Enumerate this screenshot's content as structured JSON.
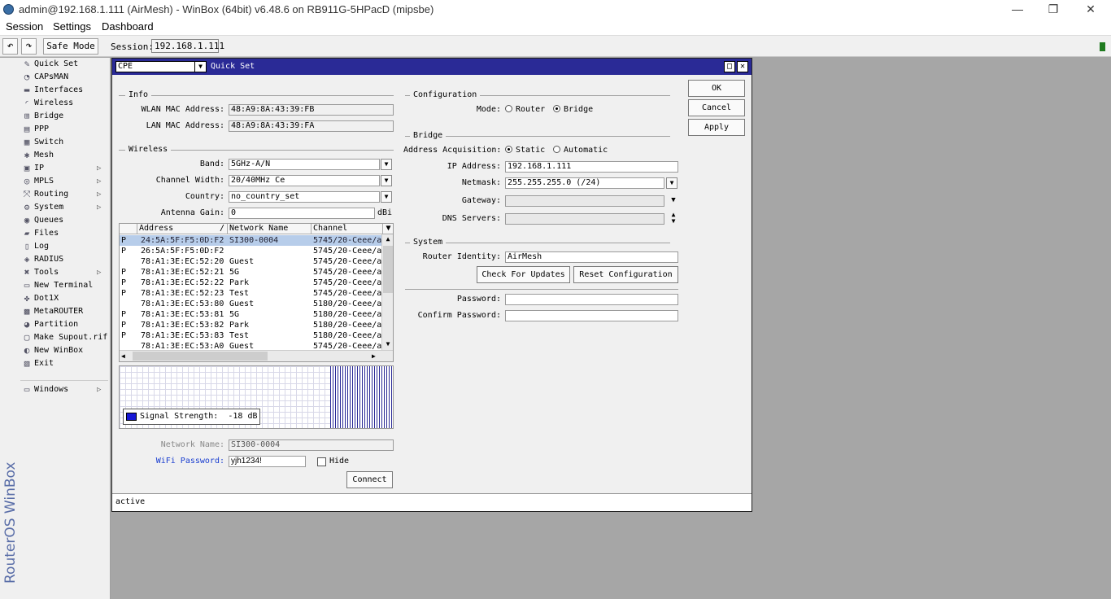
{
  "window": {
    "title": "admin@192.168.1.111 (AirMesh) - WinBox (64bit) v6.48.6 on RB911G-5HPacD (mipsbe)",
    "minimize": "—",
    "restore": "❐",
    "close": "✕"
  },
  "menu": {
    "items": [
      "Session",
      "Settings",
      "Dashboard"
    ]
  },
  "toolbar": {
    "undo": "↶",
    "redo": "↷",
    "safe_mode": "Safe Mode",
    "session_label": "Session:",
    "session_value": "192.168.1.111"
  },
  "brand": "RouterOS WinBox",
  "sidebar": {
    "items": [
      {
        "label": "Quick Set",
        "icon": "quick-set-icon",
        "glyph": "✎"
      },
      {
        "label": "CAPsMAN",
        "icon": "capsman-icon",
        "glyph": "◔"
      },
      {
        "label": "Interfaces",
        "icon": "interfaces-icon",
        "glyph": "▬"
      },
      {
        "label": "Wireless",
        "icon": "wireless-icon",
        "glyph": "◜"
      },
      {
        "label": "Bridge",
        "icon": "bridge-icon",
        "glyph": "⊞"
      },
      {
        "label": "PPP",
        "icon": "ppp-icon",
        "glyph": "▤"
      },
      {
        "label": "Switch",
        "icon": "switch-icon",
        "glyph": "▦"
      },
      {
        "label": "Mesh",
        "icon": "mesh-icon",
        "glyph": "✱"
      },
      {
        "label": "IP",
        "icon": "ip-icon",
        "glyph": "▣",
        "arrow": "▷"
      },
      {
        "label": "MPLS",
        "icon": "mpls-icon",
        "glyph": "◎",
        "arrow": "▷"
      },
      {
        "label": "Routing",
        "icon": "routing-icon",
        "glyph": "⤧",
        "arrow": "▷"
      },
      {
        "label": "System",
        "icon": "system-icon",
        "glyph": "⚙",
        "arrow": "▷"
      },
      {
        "label": "Queues",
        "icon": "queues-icon",
        "glyph": "◉"
      },
      {
        "label": "Files",
        "icon": "files-icon",
        "glyph": "▰"
      },
      {
        "label": "Log",
        "icon": "log-icon",
        "glyph": "▯"
      },
      {
        "label": "RADIUS",
        "icon": "radius-icon",
        "glyph": "◈"
      },
      {
        "label": "Tools",
        "icon": "tools-icon",
        "glyph": "✖",
        "arrow": "▷"
      },
      {
        "label": "New Terminal",
        "icon": "terminal-icon",
        "glyph": "▭"
      },
      {
        "label": "Dot1X",
        "icon": "dot1x-icon",
        "glyph": "✤"
      },
      {
        "label": "MetaROUTER",
        "icon": "metarouter-icon",
        "glyph": "▩"
      },
      {
        "label": "Partition",
        "icon": "partition-icon",
        "glyph": "◕"
      },
      {
        "label": "Make Supout.rif",
        "icon": "supout-icon",
        "glyph": "▢"
      },
      {
        "label": "New WinBox",
        "icon": "winbox-icon",
        "glyph": "◐"
      },
      {
        "label": "Exit",
        "icon": "exit-icon",
        "glyph": "▧"
      }
    ],
    "windows": {
      "label": "Windows",
      "icon": "windows-icon",
      "glyph": "▭",
      "arrow": "▷"
    }
  },
  "quickset": {
    "mode": "CPE",
    "title": "Quick Set",
    "maximize": "□",
    "close": "✕",
    "info": {
      "group": "Info",
      "wlan_mac_label": "WLAN MAC Address:",
      "wlan_mac": "48:A9:8A:43:39:FB",
      "lan_mac_label": "LAN MAC Address:",
      "lan_mac": "48:A9:8A:43:39:FA"
    },
    "wireless": {
      "group": "Wireless",
      "band_label": "Band:",
      "band": "5GHz-A/N",
      "width_label": "Channel Width:",
      "width": "20/40MHz Ce",
      "country_label": "Country:",
      "country": "no_country_set",
      "gain_label": "Antenna Gain:",
      "gain": "0",
      "gain_unit": "dBi"
    },
    "table": {
      "headers": [
        "Address",
        "Network Name",
        "Channel"
      ],
      "sort_mark": "/",
      "rows": [
        {
          "flag": "P",
          "address": "24:5A:5F:F5:0D:F2",
          "network": "SI300-0004",
          "channel": "5745/20-Ceee/a",
          "selected": true
        },
        {
          "flag": "P",
          "address": "26:5A:5F:F5:0D:F2",
          "network": "",
          "channel": "5745/20-Ceee/a"
        },
        {
          "flag": "",
          "address": "78:A1:3E:EC:52:20",
          "network": "Guest",
          "channel": "5745/20-Ceee/a"
        },
        {
          "flag": "P",
          "address": "78:A1:3E:EC:52:21",
          "network": "5G",
          "channel": "5745/20-Ceee/a"
        },
        {
          "flag": "P",
          "address": "78:A1:3E:EC:52:22",
          "network": "Park",
          "channel": "5745/20-Ceee/a"
        },
        {
          "flag": "P",
          "address": "78:A1:3E:EC:52:23",
          "network": "Test",
          "channel": "5745/20-Ceee/a"
        },
        {
          "flag": "",
          "address": "78:A1:3E:EC:53:80",
          "network": "Guest",
          "channel": "5180/20-Ceee/a"
        },
        {
          "flag": "P",
          "address": "78:A1:3E:EC:53:81",
          "network": "5G",
          "channel": "5180/20-Ceee/a"
        },
        {
          "flag": "P",
          "address": "78:A1:3E:EC:53:82",
          "network": "Park",
          "channel": "5180/20-Ceee/a"
        },
        {
          "flag": "P",
          "address": "78:A1:3E:EC:53:83",
          "network": "Test",
          "channel": "5180/20-Ceee/a"
        },
        {
          "flag": "",
          "address": "78:A1:3E:EC:53:A0",
          "network": "Guest",
          "channel": "5745/20-Ceee/a"
        }
      ]
    },
    "signal": {
      "label": "Signal Strength:",
      "value": "-18 dB",
      "color": "#1919d6"
    },
    "network_name_label": "Network Name:",
    "network_name": "SI300-0004",
    "wifi_password_label": "WiFi Password:",
    "wifi_password": "yjh1234!",
    "hide_label": "Hide",
    "connect": "Connect",
    "configuration": {
      "group": "Configuration",
      "mode_label": "Mode:",
      "router": "Router",
      "bridge": "Bridge",
      "selected": "Bridge"
    },
    "bridge": {
      "group": "Bridge",
      "acq_label": "Address Acquisition:",
      "static": "Static",
      "automatic": "Automatic",
      "ip_label": "IP Address:",
      "ip": "192.168.1.111",
      "netmask_label": "Netmask:",
      "netmask": "255.255.255.0 (/24)",
      "gateway_label": "Gateway:",
      "gateway": "",
      "dns_label": "DNS Servers:",
      "dns": ""
    },
    "system": {
      "group": "System",
      "identity_label": "Router Identity:",
      "identity": "AirMesh",
      "check_updates": "Check For Updates",
      "reset_config": "Reset Configuration"
    },
    "password_label": "Password:",
    "confirm_label": "Confirm Password:",
    "ok": "OK",
    "cancel": "Cancel",
    "apply": "Apply",
    "status": "active"
  }
}
